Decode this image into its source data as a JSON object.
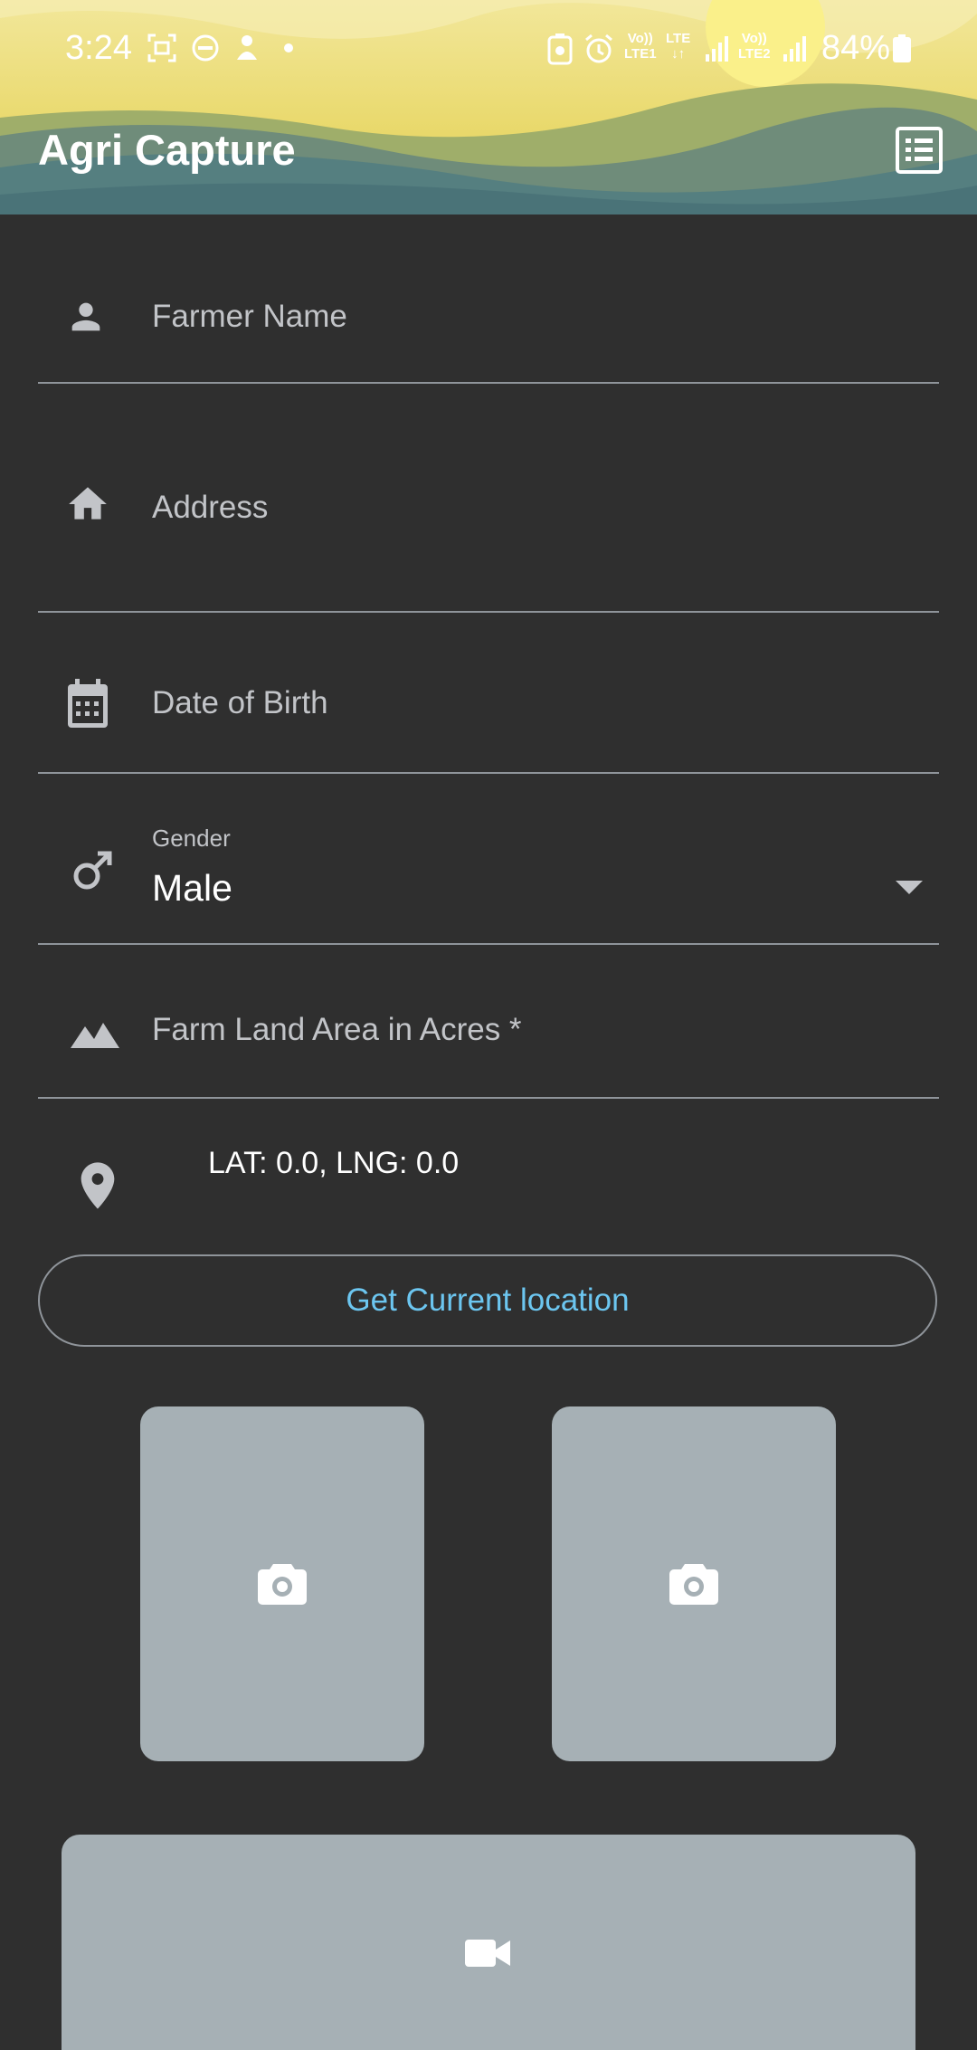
{
  "status_bar": {
    "time": "3:24",
    "battery": "84%",
    "lte1_label": "LTE1",
    "lte2_label": "LTE2",
    "lte_label": "LTE",
    "volte_label": "Vo))"
  },
  "app_bar": {
    "title": "Agri Capture"
  },
  "form": {
    "farmer_name_label": "Farmer Name",
    "address_label": "Address",
    "dob_label": "Date of Birth",
    "gender_label": "Gender",
    "gender_value": "Male",
    "farm_area_label": "Farm Land Area in Acres *",
    "location_text": "LAT: 0.0, LNG: 0.0",
    "get_location_button": "Get Current location"
  },
  "colors": {
    "background": "#2f2f2f",
    "field_label": "#c2c4c8",
    "accent_button_text": "#6cc6f0",
    "media_placeholder": "#a6b0b5"
  },
  "icons": {
    "farmer_name": "person-icon",
    "address": "home-icon",
    "dob": "calendar-icon",
    "gender": "male-icon",
    "farm_area": "landscape-icon",
    "location": "location-pin-icon",
    "photo": "camera-icon",
    "video": "videocam-icon",
    "app_bar_action": "list-icon"
  }
}
